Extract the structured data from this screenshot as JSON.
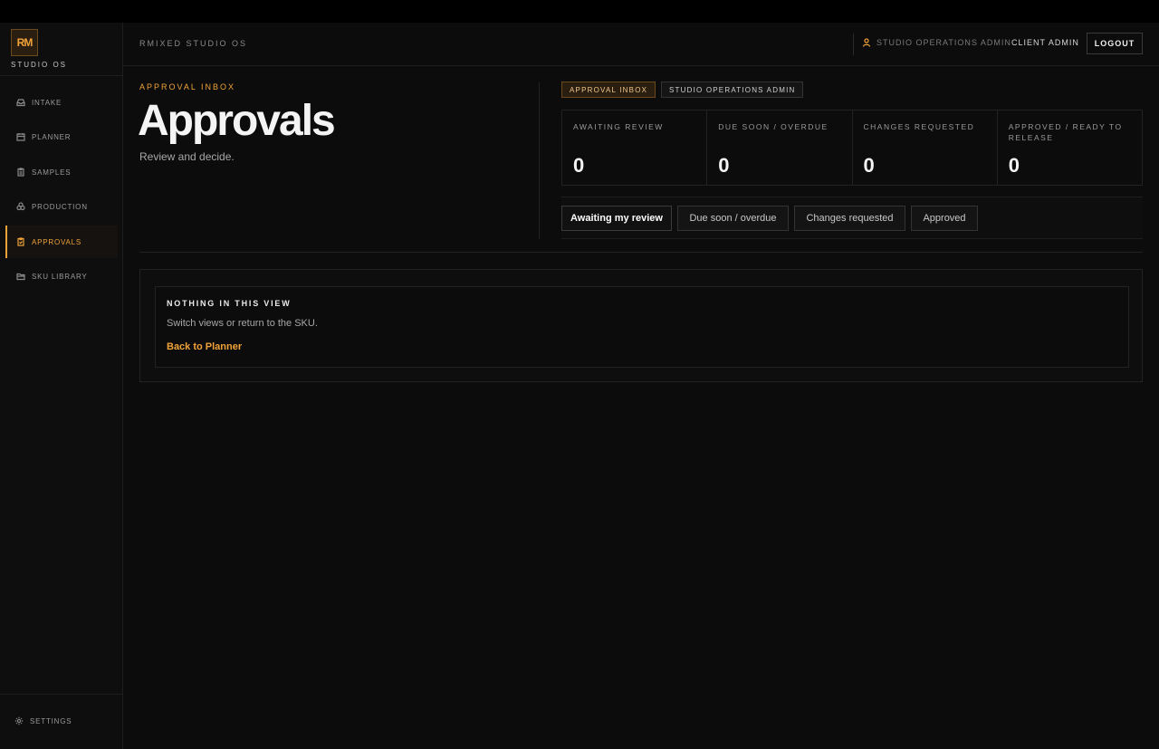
{
  "brand": {
    "logo": "RM",
    "subtitle": "STUDIO OS"
  },
  "sidebar": {
    "items": [
      {
        "label": "INTAKE",
        "icon": "inbox-icon"
      },
      {
        "label": "PLANNER",
        "icon": "calendar-icon"
      },
      {
        "label": "SAMPLES",
        "icon": "clipboard-icon"
      },
      {
        "label": "PRODUCTION",
        "icon": "layers-icon"
      },
      {
        "label": "APPROVALS",
        "icon": "clipboard-check-icon",
        "active": true
      },
      {
        "label": "SKU LIBRARY",
        "icon": "folder-icon"
      }
    ],
    "settings_label": "SETTINGS"
  },
  "header": {
    "app_title": "RMIXED STUDIO OS",
    "user_role": "STUDIO OPERATIONS ADMIN",
    "user_name": "CLIENT ADMIN",
    "logout_label": "LOGOUT"
  },
  "page": {
    "eyebrow": "APPROVAL INBOX",
    "title": "Approvals",
    "description": "Review and decide."
  },
  "chips": [
    "APPROVAL INBOX",
    "STUDIO OPERATIONS ADMIN"
  ],
  "stats": [
    {
      "label": "AWAITING REVIEW",
      "value": "0"
    },
    {
      "label": "DUE SOON / OVERDUE",
      "value": "0"
    },
    {
      "label": "CHANGES REQUESTED",
      "value": "0"
    },
    {
      "label": "APPROVED / READY TO RELEASE",
      "value": "0"
    }
  ],
  "tabs": [
    {
      "label": "Awaiting my review",
      "active": true
    },
    {
      "label": "Due soon / overdue"
    },
    {
      "label": "Changes requested"
    },
    {
      "label": "Approved"
    }
  ],
  "empty_state": {
    "title": "NOTHING IN THIS VIEW",
    "description": "Switch views or return to the SKU.",
    "link": "Back to Planner"
  },
  "colors": {
    "accent": "#f1a33a",
    "background": "#0c0c0c"
  }
}
